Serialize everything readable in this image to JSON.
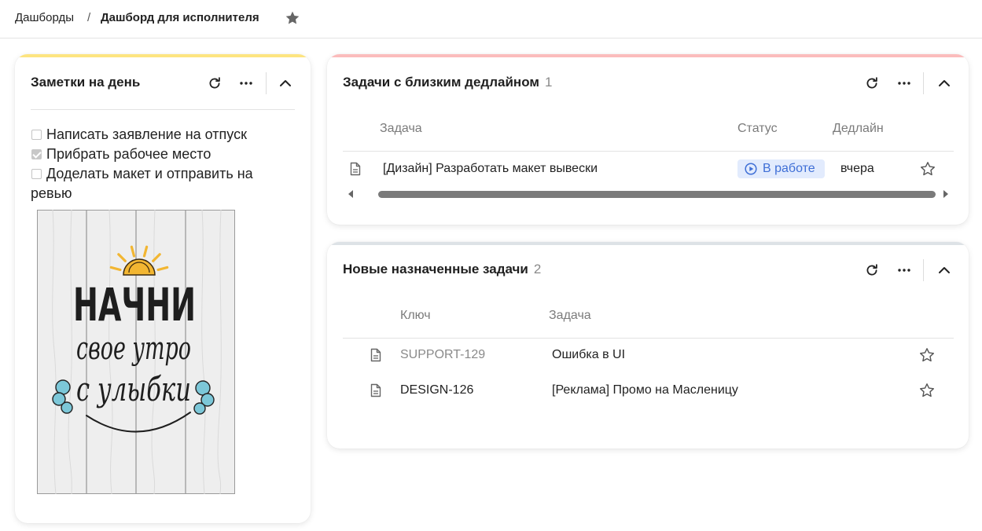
{
  "header": {
    "breadcrumbs": [
      {
        "label": "Дашборды"
      },
      {
        "label": "Дашборд для исполнителя"
      }
    ],
    "separator": "/",
    "favorite_icon": "star-filled-icon"
  },
  "colors": {
    "notes_accent": "#fde480",
    "deadline_accent": "#fbbcbc",
    "new_tasks_accent": "#dde2e6",
    "status_in_progress_bg": "#e2ebfd",
    "status_in_progress_text": "#3f6fd6",
    "poster_sun": "#f2b632",
    "poster_cloud": "#7cc7d8"
  },
  "widget_icons": [
    "refresh-icon",
    "more-horizontal-icon",
    "chevron-up-icon"
  ],
  "notes_widget": {
    "title": "Заметки на день",
    "items": [
      {
        "label": "Написать заявление на отпуск",
        "checked": false
      },
      {
        "label": "Прибрать рабочее место",
        "checked": true
      },
      {
        "label": "Доделать макет и отправить на ревью",
        "checked": false
      }
    ],
    "poster": {
      "line1": "НАЧНИ",
      "line2": "свое утро",
      "line3": "с улыбки"
    }
  },
  "deadline_widget": {
    "title": "Задачи с близким дедлайном",
    "count": "1",
    "columns": {
      "task": "Задача",
      "status": "Статус",
      "deadline": "Дедлайн"
    },
    "rows": [
      {
        "task": "[Дизайн] Разработать макет вывески",
        "status": "В работе",
        "deadline": "вчера",
        "favorite": false
      }
    ]
  },
  "new_tasks_widget": {
    "title": "Новые назначенные задачи",
    "count": "2",
    "columns": {
      "key": "Ключ",
      "task": "Задача"
    },
    "rows": [
      {
        "key": "SUPPORT-129",
        "task": "Ошибка в UI",
        "favorite": false
      },
      {
        "key": "DESIGN-126",
        "task": "[Реклама] Промо на Масленицу",
        "favorite": false
      }
    ]
  }
}
